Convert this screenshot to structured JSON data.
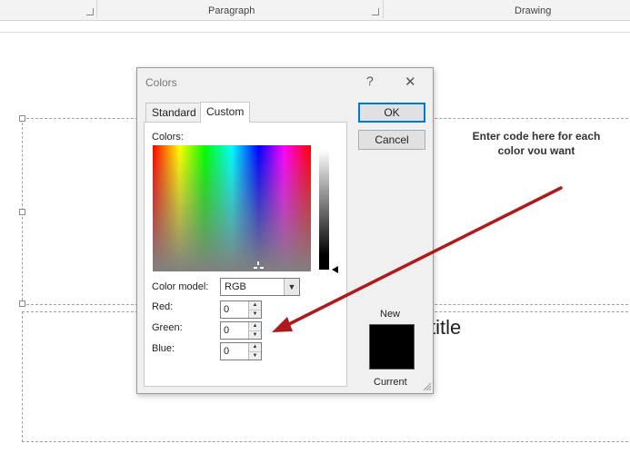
{
  "ribbon": {
    "groups": [
      "Paragraph",
      "Drawing"
    ]
  },
  "slide": {
    "subtitle_partial": "title"
  },
  "callout": {
    "text_line1": "Enter code here for each",
    "text_line2": "color vou want"
  },
  "dialog": {
    "title": "Colors",
    "help_glyph": "?",
    "close_glyph": "✕",
    "tabs": [
      {
        "label": "Standard",
        "selected": false
      },
      {
        "label": "Custom",
        "selected": true
      }
    ],
    "colors_label": "Colors:",
    "color_model_label": "Color model:",
    "color_model_value": "RGB",
    "fields": [
      {
        "label": "Red:",
        "value": "0"
      },
      {
        "label": "Green:",
        "value": "0"
      },
      {
        "label": "Blue:",
        "value": "0"
      }
    ],
    "ok_label": "OK",
    "cancel_label": "Cancel",
    "new_label": "New",
    "current_label": "Current",
    "swatch_color": "#000000"
  },
  "colors": {
    "arrow": "#b01a1a",
    "accent": "#0078d7"
  }
}
